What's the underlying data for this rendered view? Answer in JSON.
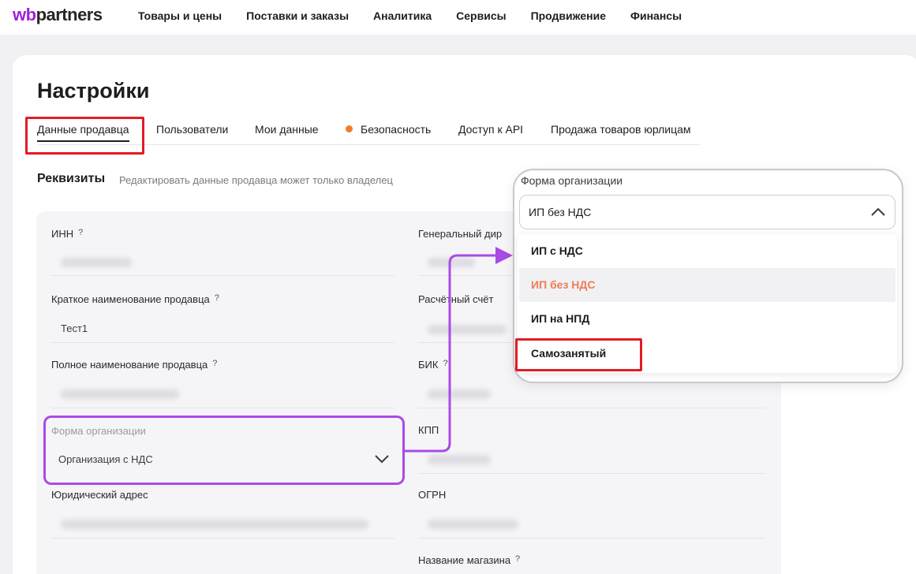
{
  "header": {
    "logo": "wbpartners",
    "logo_prefix": "wb",
    "logo_suffix": "partners",
    "nav": [
      "Товары и цены",
      "Поставки и заказы",
      "Аналитика",
      "Сервисы",
      "Продвижение",
      "Финансы"
    ]
  },
  "page": {
    "title": "Настройки",
    "tabs": [
      {
        "label": "Данные продавца",
        "active": true
      },
      {
        "label": "Пользователи",
        "active": false
      },
      {
        "label": "Мои данные",
        "active": false
      },
      {
        "label": "Безопасность",
        "active": false,
        "dot": true
      },
      {
        "label": "Доступ к API",
        "active": false
      },
      {
        "label": "Продажа товаров юрлицам",
        "active": false
      }
    ]
  },
  "section": {
    "title": "Реквизиты",
    "subtitle": "Редактировать данные продавца может только владелец"
  },
  "form": {
    "help_mark": "?",
    "inn_label": "ИНН",
    "short_name_label": "Краткое наименование продавца",
    "short_name_value": "Тест1",
    "full_name_label": "Полное наименование продавца",
    "org_form_label": "Форма организации",
    "org_form_value": "Организация с НДС",
    "legal_address_label": "Юридический адрес",
    "director_label": "Генеральный дир",
    "account_label": "Расчётный счёт",
    "bik_label": "БИК",
    "kpp_label": "КПП",
    "ogrn_label": "ОГРН",
    "shop_name_label": "Название магазина"
  },
  "popup": {
    "label": "Форма организации",
    "selected_value": "ИП без НДС",
    "options": [
      {
        "label": "ИП с НДС",
        "state": "normal"
      },
      {
        "label": "ИП без НДС",
        "state": "selected"
      },
      {
        "label": "ИП на НПД",
        "state": "normal"
      },
      {
        "label": "Самозанятый",
        "state": "highlighted"
      }
    ]
  },
  "colors": {
    "accent_purple": "#a94be6",
    "highlight_red": "#e11c24",
    "selected_orange": "#f07c52",
    "dot_orange": "#f07c2d"
  }
}
